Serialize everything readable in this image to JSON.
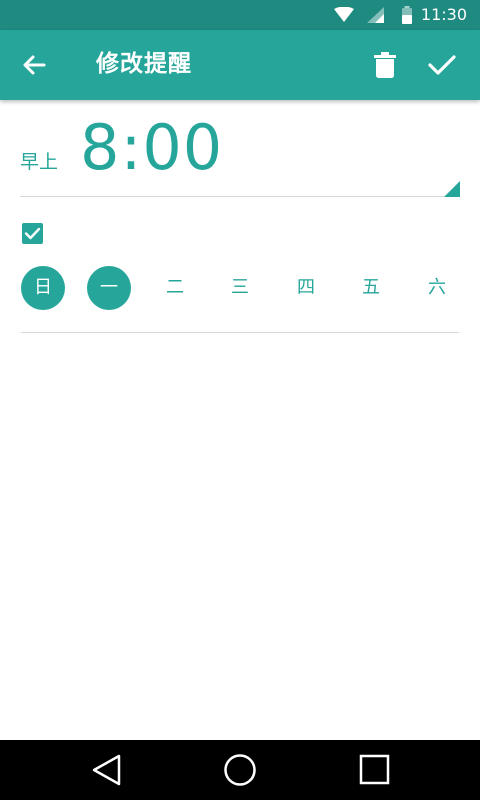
{
  "status_bar": {
    "time": "11:30",
    "icons": [
      "wifi-icon",
      "signal-icon",
      "battery-icon"
    ]
  },
  "app_bar": {
    "title": "修改提醒",
    "back_icon": "arrow-back-icon",
    "delete_icon": "trash-icon",
    "confirm_icon": "checkmark-icon"
  },
  "alarm": {
    "ampm": "早上",
    "time": "8:00",
    "repeat_checked": true
  },
  "days": [
    {
      "label": "日",
      "selected": true
    },
    {
      "label": "一",
      "selected": true
    },
    {
      "label": "二",
      "selected": false
    },
    {
      "label": "三",
      "selected": false
    },
    {
      "label": "四",
      "selected": false
    },
    {
      "label": "五",
      "selected": false
    },
    {
      "label": "六",
      "selected": false
    }
  ],
  "nav_bar": {
    "buttons": [
      "back-triangle-icon",
      "home-circle-icon",
      "recents-square-icon"
    ]
  },
  "colors": {
    "accent": "#26a69a",
    "status_bar": "#1e8a80",
    "nav_bar": "#000000"
  }
}
